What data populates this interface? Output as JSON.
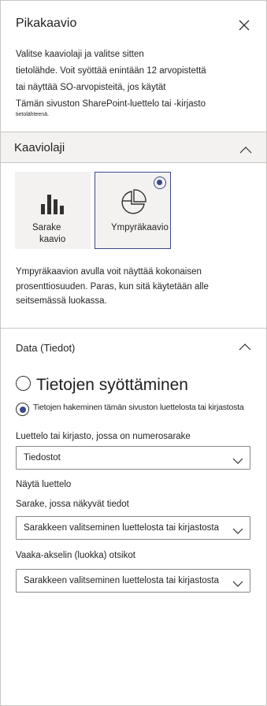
{
  "panel": {
    "title": "Pikakaavio",
    "close_icon": "close-icon",
    "intro_lines": [
      "Valitse kaaviolaji ja valitse sitten",
      "tietolähde. Voit syöttää enintään 12 arvopistettä",
      "tai näyttää SO-arvopisteitä, jos käytät",
      "Tämän sivuston SharePoint-luettelo tai -kirjasto",
      "tietolähteenä."
    ]
  },
  "chart_type_section": {
    "title": "Kaaviolaji",
    "chevron_icon": "chevron-up-icon",
    "options": [
      {
        "label_line1": "Sarake",
        "label_line2": "kaavio",
        "icon": "column-chart-icon",
        "selected": false
      },
      {
        "label": "Ympyräkaavio",
        "icon": "pie-chart-icon",
        "selected": true
      }
    ],
    "description_lines": [
      "Ympyräkaavion avulla voit näyttää kokonaisen",
      "prosenttiosuuden. Paras, kun sitä käytetään alle",
      "seitsemässä luokassa."
    ]
  },
  "data_section": {
    "title": "Data (Tiedot)",
    "chevron_icon": "chevron-up-icon",
    "radio_manual": "Tietojen syöttäminen",
    "radio_list": "Tietojen hakeminen tämän sivuston luettelosta tai kirjastosta",
    "list_label": "Luettelo tai kirjasto, jossa on numerosarake",
    "list_value": "Tiedostot",
    "show_list_link": "Näytä luettelo",
    "column_label": "Sarake, jossa näkyvät tiedot",
    "column_value": "Sarakkeen valitseminen luettelosta tai kirjastosta",
    "axis_label": "Vaaka-akselin (luokka) otsikot",
    "axis_value": "Sarakkeen valitseminen luettelosta tai kirjastosta"
  },
  "colors": {
    "accent": "#3b4a8c",
    "section_bg": "#f3f2f1",
    "border": "#c8c6c4"
  }
}
